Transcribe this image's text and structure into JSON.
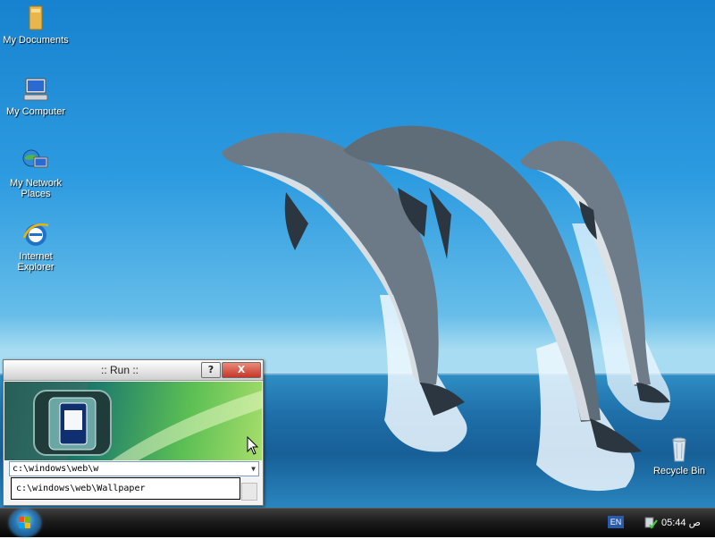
{
  "desktop": {
    "icons": [
      {
        "label": "My Documents",
        "icon": "folder-icon"
      },
      {
        "label": "My Computer",
        "icon": "computer-icon"
      },
      {
        "label": "My Network Places",
        "icon": "network-icon"
      },
      {
        "label": "Internet Explorer",
        "icon": "ie-icon"
      }
    ],
    "recycle_bin": {
      "label": "Recycle Bin",
      "icon": "recycle-bin-icon"
    }
  },
  "run_dialog": {
    "title": ":: Run ::",
    "help_label": "?",
    "close_label": "X",
    "input_value": "c:\\windows\\web\\w",
    "suggestion": "c:\\windows\\web\\Wallpaper"
  },
  "taskbar": {
    "language": "EN",
    "clock": "05:44 ص"
  },
  "colors": {
    "sky": "#2d9be0",
    "sea": "#1f6fa9",
    "taskbar": "#1c1c1c",
    "close_button": "#c5372a"
  }
}
